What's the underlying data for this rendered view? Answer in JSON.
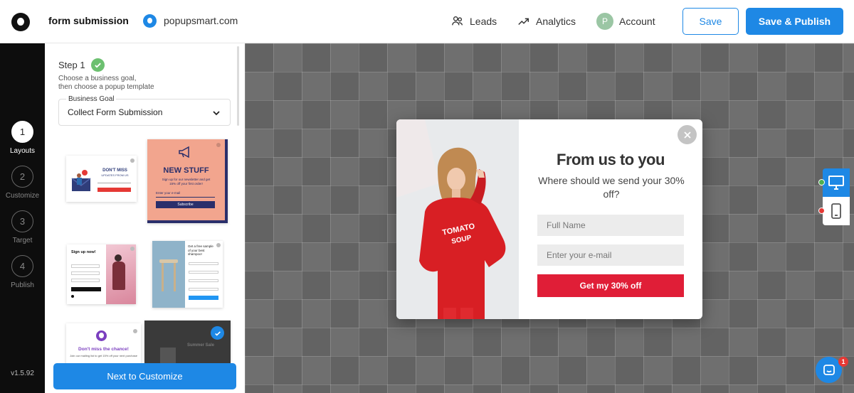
{
  "header": {
    "title": "form submission",
    "site": "popupsmart.com",
    "nav": {
      "leads": "Leads",
      "analytics": "Analytics",
      "account": "Account",
      "avatar_letter": "P"
    },
    "save_label": "Save",
    "publish_label": "Save & Publish"
  },
  "rail": {
    "steps": [
      {
        "num": "1",
        "label": "Layouts"
      },
      {
        "num": "2",
        "label": "Customize"
      },
      {
        "num": "3",
        "label": "Target"
      },
      {
        "num": "4",
        "label": "Publish"
      }
    ],
    "active_step": 1,
    "version": "v1.5.92"
  },
  "panel": {
    "step_title": "Step 1",
    "step_desc_1": "Choose a business goal,",
    "step_desc_2": "then choose a popup template",
    "goal_label": "Business Goal",
    "goal_value": "Collect Form Submission",
    "templates": {
      "t1": {
        "title_1": "DON'T MISS",
        "title_2": "UPDATES FROM US"
      },
      "t2": {
        "title": "NEW STUFF",
        "text": "Sign up for our newsletter and get 15% off your first order!",
        "input": "Enter your e-mail",
        "button": "Subscribe"
      },
      "t3": {
        "title": "Sign up now!"
      },
      "t4": {
        "title": "Get a free sample of your best shampoo!"
      },
      "t5": {
        "title": "Don't miss the chance!",
        "text": "Join our mailing list to get 15% off your next purchase"
      },
      "t6": {
        "title": "Summer Sale"
      }
    },
    "next_label": "Next to Customize"
  },
  "popup": {
    "title": "From us to you",
    "subtitle": "Where should we send your 30% off?",
    "name_placeholder": "Full Name",
    "email_placeholder": "Enter your e-mail",
    "cta": "Get my 30% off",
    "shirt_line1": "TOMATO",
    "shirt_line2": "SOUP"
  },
  "canvas": {
    "chat_badge": "1"
  },
  "colors": {
    "accent": "#1e88e5",
    "cta_red": "#e01e37",
    "success_green": "#6cc070"
  }
}
